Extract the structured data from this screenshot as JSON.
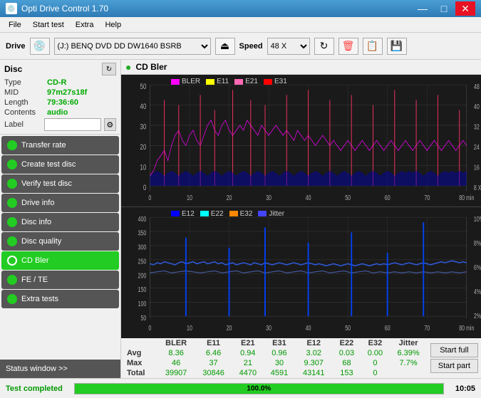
{
  "titlebar": {
    "icon": "💿",
    "title": "Opti Drive Control 1.70",
    "minimize": "—",
    "maximize": "□",
    "close": "✕"
  },
  "menu": {
    "items": [
      "File",
      "Start test",
      "Extra",
      "Help"
    ]
  },
  "toolbar": {
    "drive_label": "Drive",
    "drive_value": "(J:)  BENQ DVD DD DW1640 BSRB",
    "speed_label": "Speed",
    "speed_value": "48 X"
  },
  "disc": {
    "header": "Disc",
    "type_label": "Type",
    "type_value": "CD-R",
    "mid_label": "MID",
    "mid_value": "97m27s18f",
    "length_label": "Length",
    "length_value": "79:36:60",
    "contents_label": "Contents",
    "contents_value": "audio",
    "label_label": "Label",
    "label_value": ""
  },
  "nav": {
    "items": [
      {
        "id": "transfer-rate",
        "label": "Transfer rate"
      },
      {
        "id": "create-test-disc",
        "label": "Create test disc"
      },
      {
        "id": "verify-test-disc",
        "label": "Verify test disc"
      },
      {
        "id": "drive-info",
        "label": "Drive info"
      },
      {
        "id": "disc-info",
        "label": "Disc info"
      },
      {
        "id": "disc-quality",
        "label": "Disc quality"
      },
      {
        "id": "cd-bler",
        "label": "CD Bler",
        "active": true
      },
      {
        "id": "fe-te",
        "label": "FE / TE"
      },
      {
        "id": "extra-tests",
        "label": "Extra tests"
      }
    ]
  },
  "status_window": {
    "label": "Status window >>"
  },
  "chart": {
    "icon": "●",
    "title": "CD Bler",
    "upper_legend": [
      {
        "color": "#ff00ff",
        "label": "BLER"
      },
      {
        "color": "#ffff00",
        "label": "E11"
      },
      {
        "color": "#ff69b4",
        "label": "E21"
      },
      {
        "color": "#ff0000",
        "label": "E31"
      }
    ],
    "lower_legend": [
      {
        "color": "#0000ff",
        "label": "E12"
      },
      {
        "color": "#00ffff",
        "label": "E22"
      },
      {
        "color": "#ff8800",
        "label": "E32"
      },
      {
        "color": "#4444ff",
        "label": "Jitter"
      }
    ],
    "upper_y_labels": [
      "50",
      "40",
      "30",
      "20",
      "10",
      "0"
    ],
    "upper_y_right": [
      "48 X",
      "40 X",
      "32 X",
      "24 X",
      "16 X",
      "8 X"
    ],
    "lower_y_labels": [
      "400",
      "350",
      "300",
      "250",
      "200",
      "150",
      "100",
      "50",
      "0"
    ],
    "lower_y_right": [
      "10%",
      "8%",
      "6%",
      "4%",
      "2%"
    ],
    "x_labels": [
      "0",
      "10",
      "20",
      "30",
      "40",
      "50",
      "60",
      "70",
      "80 min"
    ]
  },
  "stats": {
    "headers": [
      "",
      "BLER",
      "E11",
      "E21",
      "E31",
      "E12",
      "E22",
      "E32",
      "Jitter",
      ""
    ],
    "avg": {
      "label": "Avg",
      "values": [
        "8.36",
        "6.46",
        "0.94",
        "0.96",
        "3.02",
        "0.03",
        "0.00",
        "6.39%"
      ]
    },
    "max": {
      "label": "Max",
      "values": [
        "46",
        "37",
        "21",
        "30",
        "9.307",
        "68",
        "0",
        "7.7%"
      ]
    },
    "total": {
      "label": "Total",
      "values": [
        "39907",
        "30846",
        "4470",
        "4591",
        "43141",
        "153",
        "0",
        ""
      ]
    }
  },
  "buttons": {
    "start_full": "Start full",
    "start_part": "Start part"
  },
  "status_bar": {
    "status": "Test completed",
    "progress": "100.0%",
    "progress_value": 100,
    "time": "10:05"
  }
}
